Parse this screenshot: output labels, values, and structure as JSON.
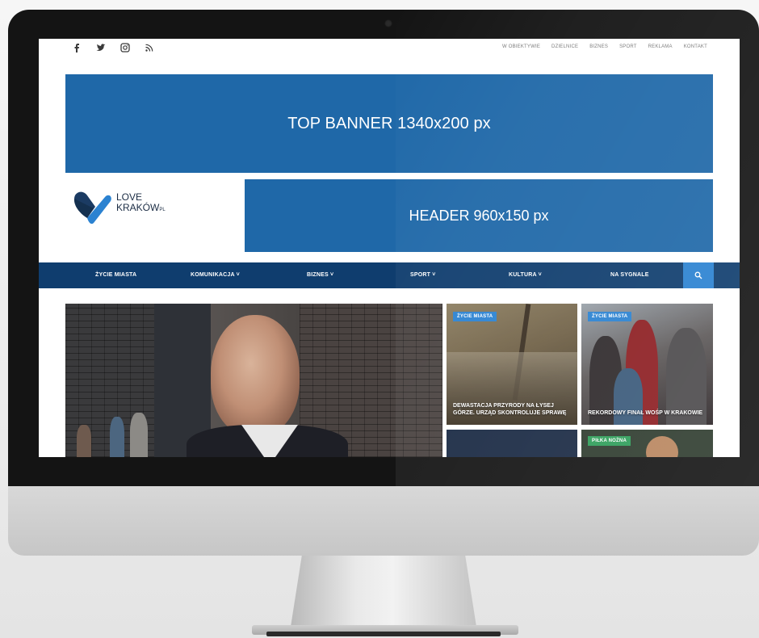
{
  "social": {
    "icons": [
      "facebook-icon",
      "twitter-icon",
      "instagram-icon",
      "rss-icon"
    ]
  },
  "topnav": {
    "items": [
      "W OBIEKTYWIE",
      "DZIELNICE",
      "BIZNES",
      "SPORT",
      "REKLAMA",
      "KONTAKT"
    ]
  },
  "banners": {
    "top": "TOP BANNER 1340x200 px",
    "header": "HEADER 960x150 px"
  },
  "logo": {
    "line1": "LOVE",
    "line2": "KRAKÓW",
    "suffix": "PL"
  },
  "mainnav": {
    "items": [
      "ŻYCIE MIASTA",
      "KOMUNIKACJA  ˅",
      "BIZNES  ˅",
      "SPORT  ˅",
      "KULTURA  ˅",
      "NA SYGNALE"
    ]
  },
  "tiles": [
    {
      "category": "ŻYCIE MIASTA",
      "title": "DEWASTACJA PRZYRODY NA ŁYSEJ GÓRZE. URZĄD SKONTROLUJE SPRAWĘ"
    },
    {
      "category": "ŻYCIE MIASTA",
      "title": "REKORDOWY FINAŁ WOŚP W KRAKOWIE"
    },
    {
      "category": "PIŁKA NOŻNA",
      "title": ""
    }
  ],
  "colors": {
    "banner_blue": "#1f68a8",
    "nav_navy": "#0f3d6e",
    "accent_blue": "#2b82d1",
    "category_green": "#2f9e5a"
  }
}
